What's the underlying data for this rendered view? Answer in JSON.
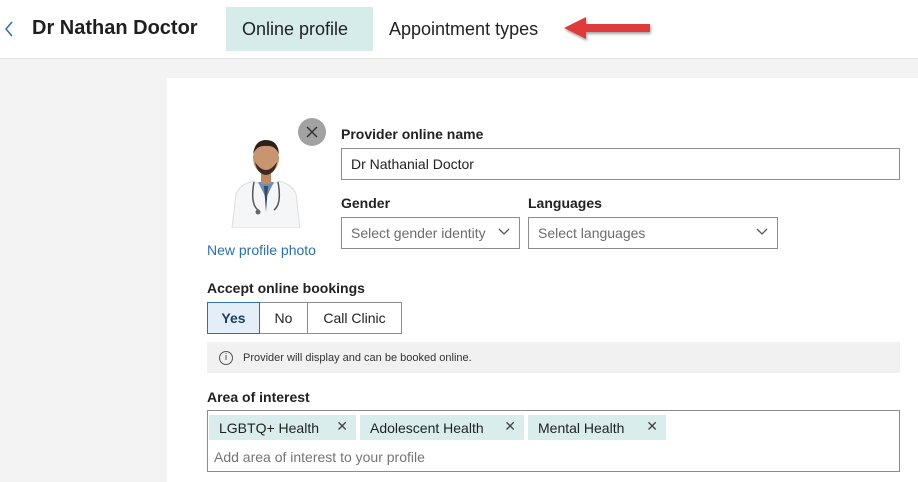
{
  "header": {
    "title": "Dr Nathan Doctor",
    "tabs": [
      {
        "label": "Online profile",
        "active": true
      },
      {
        "label": "Appointment types",
        "active": false
      }
    ]
  },
  "profile": {
    "new_photo_link": "New profile photo",
    "online_name": {
      "label": "Provider online name",
      "value": "Dr Nathanial Doctor"
    },
    "gender": {
      "label": "Gender",
      "placeholder": "Select gender identity"
    },
    "languages": {
      "label": "Languages",
      "placeholder": "Select languages"
    },
    "bookings": {
      "label": "Accept online bookings",
      "options": [
        "Yes",
        "No",
        "Call Clinic"
      ],
      "selected": "Yes",
      "info": "Provider will display and can be booked online."
    },
    "interests": {
      "label": "Area of interest",
      "tags": [
        "LGBTQ+ Health",
        "Adolescent Health",
        "Mental Health"
      ],
      "placeholder": "Add area of interest to your profile"
    }
  },
  "colors": {
    "accent_tab": "#d6ecea",
    "tag_bg": "#d9eeec",
    "link": "#2a6fb0",
    "annotation_arrow": "#e03a3a"
  },
  "icons": [
    "chevron-left-icon",
    "close-icon",
    "chevron-down-icon",
    "info-icon",
    "arrow-left-icon"
  ]
}
